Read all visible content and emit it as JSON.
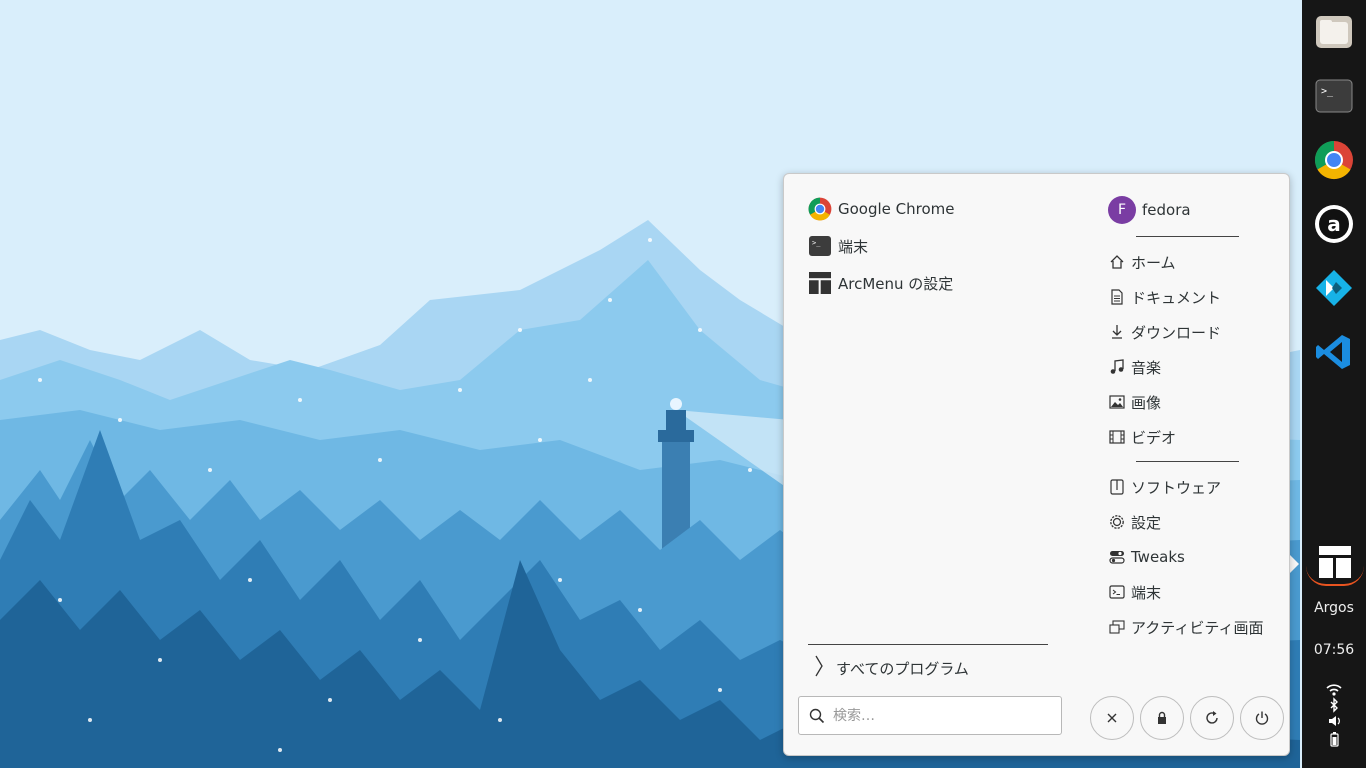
{
  "dock": {
    "apps": [
      {
        "name": "files-icon"
      },
      {
        "name": "terminal-icon"
      },
      {
        "name": "chrome-icon"
      },
      {
        "name": "anydesk-icon"
      },
      {
        "name": "kodi-icon"
      },
      {
        "name": "vscode-icon"
      },
      {
        "name": "arcmenu-icon"
      }
    ],
    "label": "Argos",
    "clock": "07:56"
  },
  "menu": {
    "favorites": [
      {
        "label": "Google Chrome",
        "icon": "chrome-icon"
      },
      {
        "label": "端末",
        "icon": "terminal-icon"
      },
      {
        "label": "ArcMenu の設定",
        "icon": "arcmenu-icon"
      }
    ],
    "all_programs_label": "すべてのプログラム",
    "search": {
      "placeholder": "検索…"
    },
    "user": {
      "initial": "F",
      "name": "fedora"
    },
    "places": [
      {
        "label": "ホーム",
        "icon": "home-icon"
      },
      {
        "label": "ドキュメント",
        "icon": "document-icon"
      },
      {
        "label": "ダウンロード",
        "icon": "download-icon"
      },
      {
        "label": "音楽",
        "icon": "music-icon"
      },
      {
        "label": "画像",
        "icon": "picture-icon"
      },
      {
        "label": "ビデオ",
        "icon": "video-icon"
      }
    ],
    "system": [
      {
        "label": "ソフトウェア",
        "icon": "software-icon"
      },
      {
        "label": "設定",
        "icon": "settings-icon"
      },
      {
        "label": "Tweaks",
        "icon": "tweaks-icon"
      },
      {
        "label": "端末",
        "icon": "terminal-icon"
      },
      {
        "label": "アクティビティ画面",
        "icon": "activities-icon"
      }
    ],
    "session_buttons": [
      "logout-icon",
      "lock-icon",
      "restart-icon",
      "power-icon"
    ]
  },
  "colors": {
    "sky": "#d9eefb",
    "dock_bg": "#161616",
    "menu_bg": "#f8f8f8",
    "avatar": "#7a3da3",
    "accent": "#e95420"
  }
}
